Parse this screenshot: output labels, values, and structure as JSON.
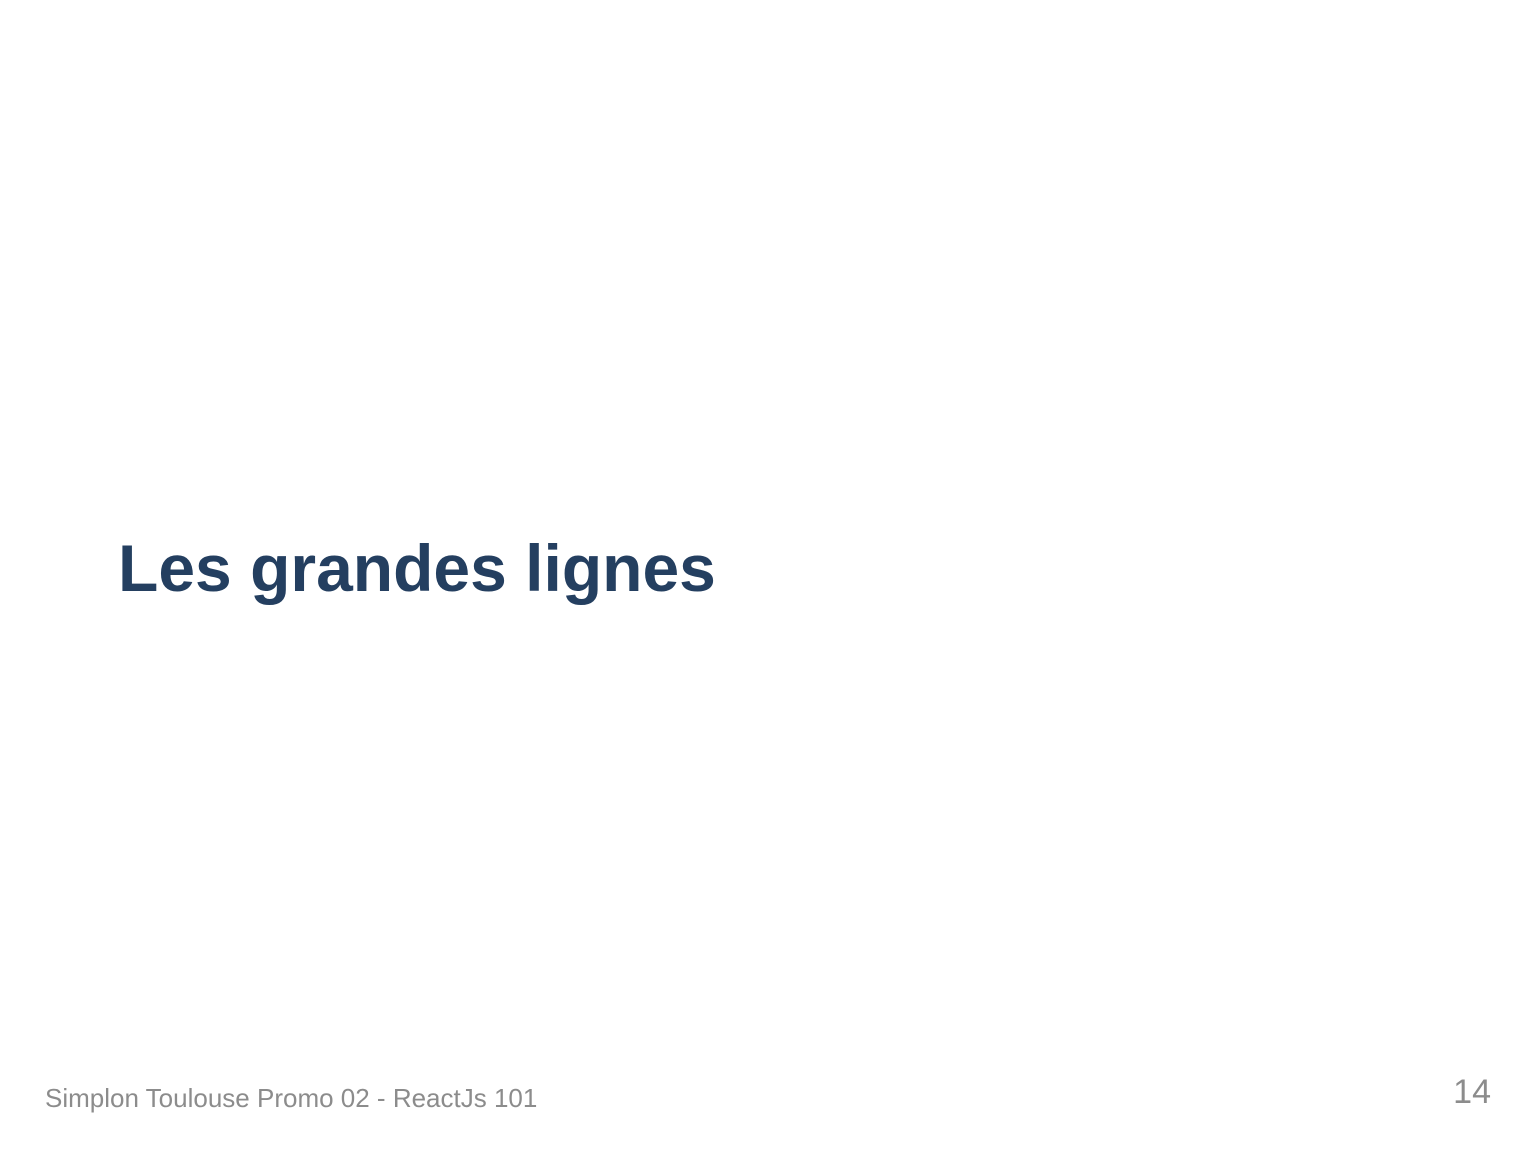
{
  "slide": {
    "title": "Les grandes lignes",
    "footer": "Simplon Toulouse Promo 02 - ReactJs 101",
    "page_number": "14"
  },
  "colors": {
    "title": "#243f60",
    "footer": "#8c8c8c",
    "background": "#ffffff"
  }
}
